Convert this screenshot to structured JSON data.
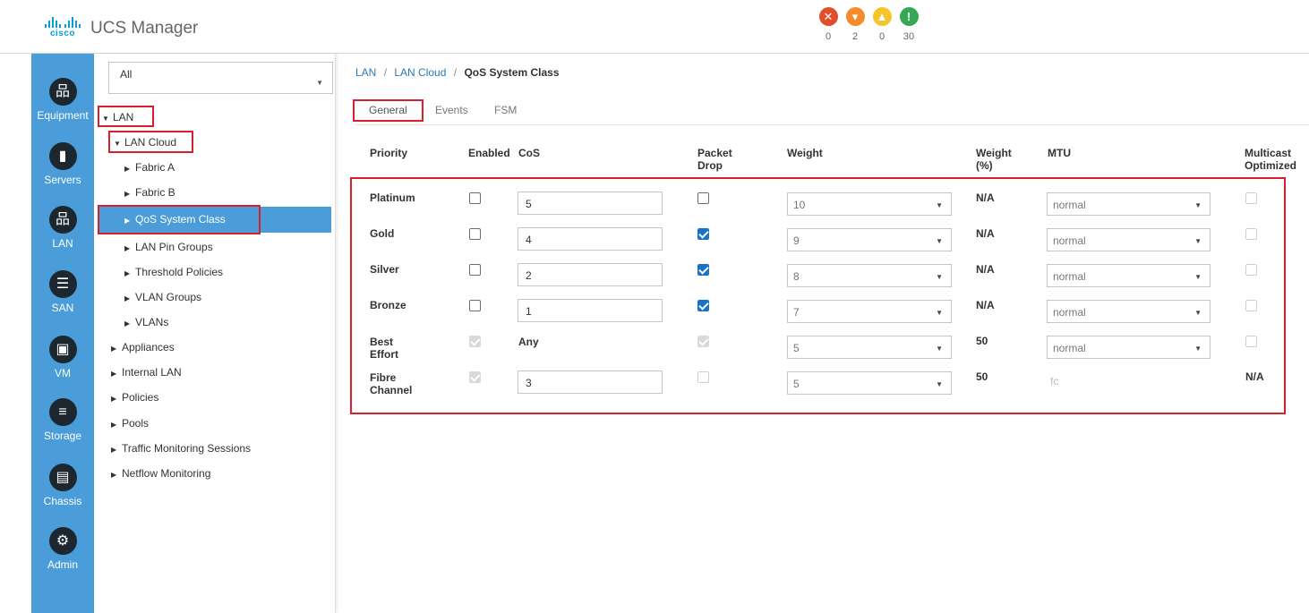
{
  "header": {
    "brand": "cisco",
    "app_title": "UCS Manager",
    "faults": [
      {
        "type": "critical",
        "count": "0",
        "color": "#e04e2c",
        "glyph": "✕"
      },
      {
        "type": "major",
        "count": "2",
        "color": "#f58b2a",
        "glyph": "▾"
      },
      {
        "type": "minor",
        "count": "0",
        "color": "#f5c52a",
        "glyph": "▲"
      },
      {
        "type": "warning",
        "count": "30",
        "color": "#34a853",
        "glyph": "!"
      }
    ]
  },
  "nav": {
    "items": [
      {
        "label": "Equipment",
        "icon": "equipment-icon",
        "glyph": "品"
      },
      {
        "label": "Servers",
        "icon": "server-icon",
        "glyph": "▮"
      },
      {
        "label": "LAN",
        "icon": "lan-icon",
        "glyph": "品"
      },
      {
        "label": "SAN",
        "icon": "san-icon",
        "glyph": "☰"
      },
      {
        "label": "VM",
        "icon": "vm-icon",
        "glyph": "▣"
      },
      {
        "label": "Storage",
        "icon": "storage-icon",
        "glyph": "≡"
      },
      {
        "label": "Chassis",
        "icon": "chassis-icon",
        "glyph": "▤"
      },
      {
        "label": "Admin",
        "icon": "admin-icon",
        "glyph": "⚙"
      }
    ],
    "active": "LAN"
  },
  "tree": {
    "filter_value": "All",
    "nodes": [
      {
        "label": "LAN",
        "expanded": true
      },
      {
        "label": "LAN Cloud",
        "expanded": true
      },
      {
        "label": "Fabric A"
      },
      {
        "label": "Fabric B"
      },
      {
        "label": "QoS System Class",
        "selected": true
      },
      {
        "label": "LAN Pin Groups"
      },
      {
        "label": "Threshold Policies"
      },
      {
        "label": "VLAN Groups"
      },
      {
        "label": "VLANs"
      },
      {
        "label": "Appliances"
      },
      {
        "label": "Internal LAN"
      },
      {
        "label": "Policies"
      },
      {
        "label": "Pools"
      },
      {
        "label": "Traffic Monitoring Sessions"
      },
      {
        "label": "Netflow Monitoring"
      }
    ]
  },
  "breadcrumb": {
    "items": [
      "LAN",
      "LAN Cloud"
    ],
    "current": "QoS System Class",
    "separator": "/"
  },
  "tabs": [
    {
      "label": "General",
      "active": true
    },
    {
      "label": "Events"
    },
    {
      "label": "FSM"
    }
  ],
  "table": {
    "columns": {
      "priority": "Priority",
      "enabled": "Enabled",
      "cos": "CoS",
      "packet_drop_1": "Packet",
      "packet_drop_2": "Drop",
      "weight": "Weight",
      "weight_pct_1": "Weight",
      "weight_pct_2": "(%)",
      "mtu": "MTU",
      "multicast_1": "Multicast",
      "multicast_2": "Optimized"
    },
    "rows": [
      {
        "label1": "Platinum",
        "label2": "",
        "enabled": false,
        "cos": "5",
        "packet_drop": false,
        "weight": "10",
        "weight_pct": "N/A",
        "mtu": "normal",
        "multicast": ""
      },
      {
        "label1": "Gold",
        "label2": "",
        "enabled": false,
        "cos": "4",
        "packet_drop": true,
        "weight": "9",
        "weight_pct": "N/A",
        "mtu": "normal",
        "multicast": ""
      },
      {
        "label1": "Silver",
        "label2": "",
        "enabled": false,
        "cos": "2",
        "packet_drop": true,
        "weight": "8",
        "weight_pct": "N/A",
        "mtu": "normal",
        "multicast": ""
      },
      {
        "label1": "Bronze",
        "label2": "",
        "enabled": false,
        "cos": "1",
        "packet_drop": true,
        "weight": "7",
        "weight_pct": "N/A",
        "mtu": "normal",
        "multicast": ""
      },
      {
        "label1": "Best",
        "label2": "Effort",
        "enabled": true,
        "cos": "Any",
        "packet_drop": true,
        "weight": "5",
        "weight_pct": "50",
        "mtu": "normal",
        "multicast": ""
      },
      {
        "label1": "Fibre",
        "label2": "Channel",
        "enabled": true,
        "cos": "3",
        "packet_drop": false,
        "weight": "5",
        "weight_pct": "50",
        "mtu": "fc",
        "multicast": "N/A"
      }
    ]
  },
  "colors": {
    "accent": "#4a9dd8",
    "highlight_box": "#d6202f",
    "checkbox_on": "#1a73c9"
  }
}
